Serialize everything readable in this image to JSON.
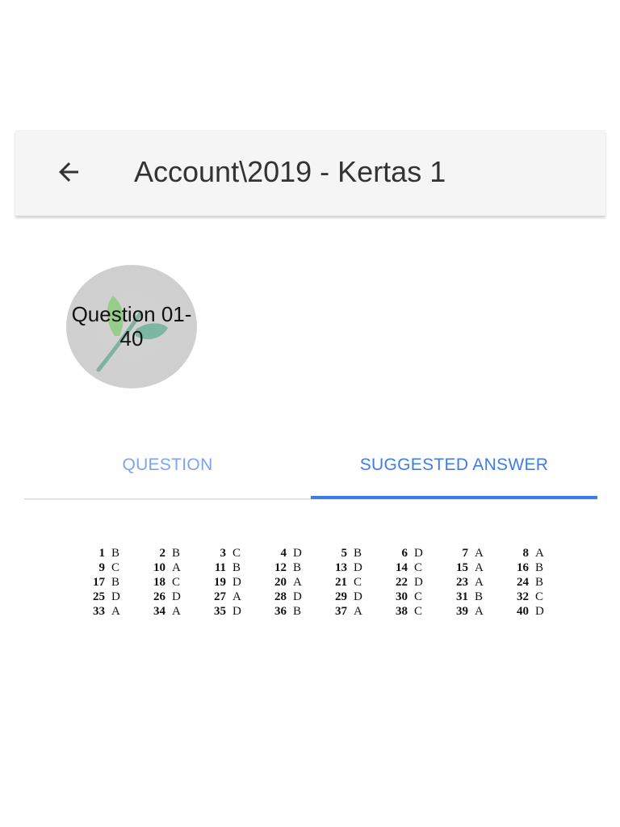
{
  "header": {
    "title": "Account\\2019 - Kertas 1",
    "back_icon": "arrow-left-icon"
  },
  "section": {
    "label": "Question 01-40",
    "badge_icon": "leaf-icon"
  },
  "tabs": [
    {
      "label": "QUESTION",
      "selected": false
    },
    {
      "label": "SUGGESTED ANSWER",
      "selected": true
    }
  ],
  "colors": {
    "accent": "#3f7de4",
    "accent_light": "#7ea4ef",
    "appbar_bg": "#f5f5f5",
    "badge_gold": "#c8a040"
  },
  "answers": [
    [
      {
        "n": "1",
        "a": "B"
      },
      {
        "n": "2",
        "a": "B"
      },
      {
        "n": "3",
        "a": "C"
      },
      {
        "n": "4",
        "a": "D"
      },
      {
        "n": "5",
        "a": "B"
      },
      {
        "n": "6",
        "a": "D"
      },
      {
        "n": "7",
        "a": "A"
      },
      {
        "n": "8",
        "a": "A"
      }
    ],
    [
      {
        "n": "9",
        "a": "C"
      },
      {
        "n": "10",
        "a": "A"
      },
      {
        "n": "11",
        "a": "B"
      },
      {
        "n": "12",
        "a": "B"
      },
      {
        "n": "13",
        "a": "D"
      },
      {
        "n": "14",
        "a": "C"
      },
      {
        "n": "15",
        "a": "A"
      },
      {
        "n": "16",
        "a": "B"
      }
    ],
    [
      {
        "n": "17",
        "a": "B"
      },
      {
        "n": "18",
        "a": "C"
      },
      {
        "n": "19",
        "a": "D"
      },
      {
        "n": "20",
        "a": "A"
      },
      {
        "n": "21",
        "a": "C"
      },
      {
        "n": "22",
        "a": "D"
      },
      {
        "n": "23",
        "a": "A"
      },
      {
        "n": "24",
        "a": "B"
      }
    ],
    [
      {
        "n": "25",
        "a": "D"
      },
      {
        "n": "26",
        "a": "D"
      },
      {
        "n": "27",
        "a": "A"
      },
      {
        "n": "28",
        "a": "D"
      },
      {
        "n": "29",
        "a": "D"
      },
      {
        "n": "30",
        "a": "C"
      },
      {
        "n": "31",
        "a": "B"
      },
      {
        "n": "32",
        "a": "C"
      }
    ],
    [
      {
        "n": "33",
        "a": "A"
      },
      {
        "n": "34",
        "a": "A"
      },
      {
        "n": "35",
        "a": "D"
      },
      {
        "n": "36",
        "a": "B"
      },
      {
        "n": "37",
        "a": "A"
      },
      {
        "n": "38",
        "a": "C"
      },
      {
        "n": "39",
        "a": "A"
      },
      {
        "n": "40",
        "a": "D"
      }
    ]
  ]
}
